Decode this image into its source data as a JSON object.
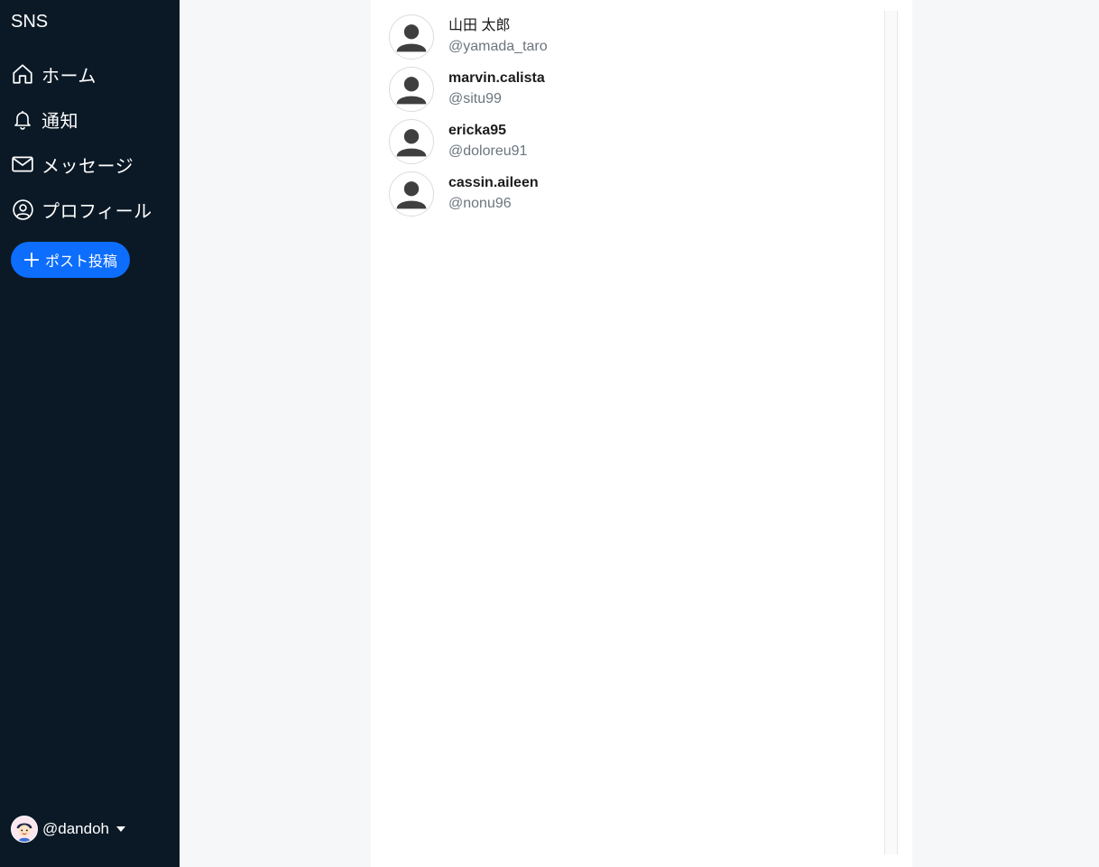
{
  "app": {
    "brand": "SNS"
  },
  "sidebar": {
    "items": [
      {
        "label": "ホーム",
        "icon": "home-icon"
      },
      {
        "label": "通知",
        "icon": "bell-icon"
      },
      {
        "label": "メッセージ",
        "icon": "envelope-icon"
      },
      {
        "label": "プロフィール",
        "icon": "person-circle-icon"
      }
    ],
    "post_button": {
      "label": "ポスト投稿",
      "icon": "plus-icon"
    },
    "current_user": {
      "handle": "@dandoh",
      "icon": "caret-down-icon"
    }
  },
  "users": [
    {
      "display_name": "山田 太郎",
      "handle": "@yamada_taro"
    },
    {
      "display_name": "marvin.calista",
      "handle": "@situ99"
    },
    {
      "display_name": "ericka95",
      "handle": "@doloreu91"
    },
    {
      "display_name": "cassin.aileen",
      "handle": "@nonu96"
    }
  ],
  "colors": {
    "sidebar_bg": "#0b1926",
    "accent": "#0d6efd",
    "page_bg": "#f6f7f9",
    "muted_text": "#6c757d"
  }
}
